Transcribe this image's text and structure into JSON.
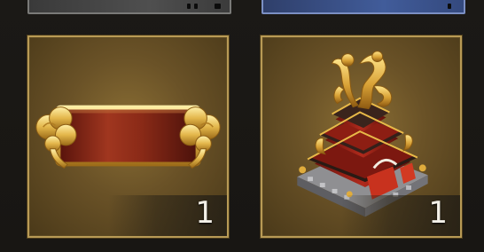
{
  "inventory": {
    "items": [
      {
        "name": "frame-ornament",
        "icon": "golden-scroll-frame-icon",
        "count": "1"
      },
      {
        "name": "dragon-palace",
        "icon": "dragon-palace-icon",
        "count": "1"
      }
    ]
  },
  "colors": {
    "card_border": "#b89a55",
    "card_fill": "#6a5227",
    "background": "#191714",
    "top_slot_gray": "#4f4f4f",
    "top_slot_blue": "#415c9a"
  }
}
